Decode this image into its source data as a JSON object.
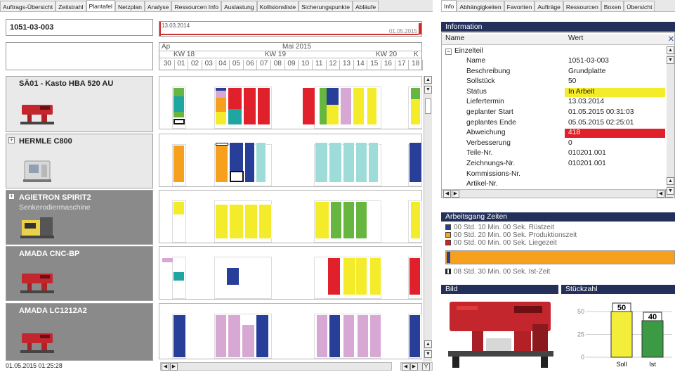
{
  "left_tabs": [
    {
      "label": "Auftrags-Übersicht",
      "active": false
    },
    {
      "label": "Zeitstrahl",
      "active": false
    },
    {
      "label": "Plantafel",
      "active": true
    },
    {
      "label": "Netzplan",
      "active": false
    },
    {
      "label": "Analyse",
      "active": false
    },
    {
      "label": "Ressourcen Info",
      "active": false
    },
    {
      "label": "Auslastung",
      "active": false
    },
    {
      "label": "Kollisionsliste",
      "active": false
    },
    {
      "label": "Sicherungspunkte",
      "active": false
    },
    {
      "label": "Abläufe",
      "active": false
    }
  ],
  "right_tabs": [
    {
      "label": "Info",
      "active": true
    },
    {
      "label": "Abhängigkeiten",
      "active": false
    },
    {
      "label": "Favoriten",
      "active": false
    },
    {
      "label": "Aufträge",
      "active": false
    },
    {
      "label": "Ressourcen",
      "active": false
    },
    {
      "label": "Boxen",
      "active": false
    },
    {
      "label": "Übersicht",
      "active": false
    }
  ],
  "order_id": "1051-03-003",
  "timeline": {
    "start_label": "13.03.2014",
    "end_label": "01.05.2015",
    "month_prev": "Ap",
    "month": "Mai 2015",
    "weeks": [
      "KW 18",
      "KW 19",
      "KW 20",
      "K"
    ],
    "days": [
      "30",
      "01",
      "02",
      "03",
      "04",
      "05",
      "06",
      "07",
      "08",
      "09",
      "10",
      "11",
      "12",
      "13",
      "14",
      "15",
      "16",
      "17",
      "18"
    ]
  },
  "machines": [
    {
      "name": "SÄ01 - Kasto HBA 520 AU",
      "subtitle": "",
      "shade": "light",
      "thumb": "saw",
      "expander": false
    },
    {
      "name": "HERMLE C800",
      "subtitle": "",
      "shade": "light",
      "thumb": "mill",
      "expander": true
    },
    {
      "name": "AGIETRON SPIRIT2",
      "subtitle": "Senkerodiermaschine",
      "shade": "dark",
      "thumb": "edm",
      "expander": true
    },
    {
      "name": "AMADA CNC-BP",
      "subtitle": "",
      "shade": "dark",
      "thumb": "saw",
      "expander": false
    },
    {
      "name": "AMADA LC1212A2",
      "subtitle": "",
      "shade": "dark",
      "thumb": "saw",
      "expander": false
    }
  ],
  "status_time": "01.05.2015 01:25:28",
  "info": {
    "title": "Information",
    "col_name": "Name",
    "col_value": "Wert",
    "group": "Einzelteil",
    "rows": [
      {
        "key": "Name",
        "value": "1051-03-003",
        "highlight": ""
      },
      {
        "key": "Beschreibung",
        "value": "Grundplatte",
        "highlight": ""
      },
      {
        "key": "Sollstück",
        "value": "50",
        "highlight": ""
      },
      {
        "key": "Status",
        "value": "In Arbeit",
        "highlight": "yellow"
      },
      {
        "key": "Liefertermin",
        "value": "13.03.2014",
        "highlight": ""
      },
      {
        "key": "geplanter Start",
        "value": "01.05.2015 00:31:03",
        "highlight": ""
      },
      {
        "key": "geplantes Ende",
        "value": "05.05.2015 02:25:01",
        "highlight": ""
      },
      {
        "key": "Abweichung",
        "value": "418",
        "highlight": "red"
      },
      {
        "key": "Verbesserung",
        "value": "0",
        "highlight": ""
      },
      {
        "key": "Teile-Nr.",
        "value": "010201.001",
        "highlight": ""
      },
      {
        "key": "Zeichnungs-Nr.",
        "value": "010201.001",
        "highlight": ""
      },
      {
        "key": "Kommissions-Nr.",
        "value": "",
        "highlight": ""
      },
      {
        "key": "Artikel-Nr.",
        "value": "",
        "highlight": ""
      }
    ]
  },
  "arbeitsgang": {
    "title": "Arbeitsgang Zeiten",
    "lines": [
      {
        "text": "00 Std. 10 Min. 00 Sek. Rüstzeit",
        "color": "#2a3f8f"
      },
      {
        "text": "00 Std. 20 Min. 00 Sek. Produktionszeit",
        "color": "#f5a623"
      },
      {
        "text": "00 Std. 00 Min. 00 Sek. Liegezeit",
        "color": "#d0201f"
      }
    ],
    "ist_text": "08 Std. 30 Min. 00 Sek. Ist-Zeit"
  },
  "bild_title": "Bild",
  "stueckzahl": {
    "title": "Stückzahl",
    "chart_data": {
      "type": "bar",
      "categories": [
        "Soll",
        "Ist"
      ],
      "values": [
        50,
        40
      ],
      "colors": [
        "#f3ee3a",
        "#3d9a44"
      ],
      "ylim": [
        0,
        60
      ],
      "yticks": [
        "0",
        "25",
        "50"
      ]
    }
  },
  "colors": {
    "header_bg": "#23315a",
    "yellow": "#f4ec2a",
    "red": "#e0202a",
    "blue": "#283f99",
    "teal": "#1fa5a2",
    "cyan": "#9ddcd9",
    "green": "#67b640",
    "lilac": "#d8a8d4",
    "orange": "#f6a01e"
  }
}
